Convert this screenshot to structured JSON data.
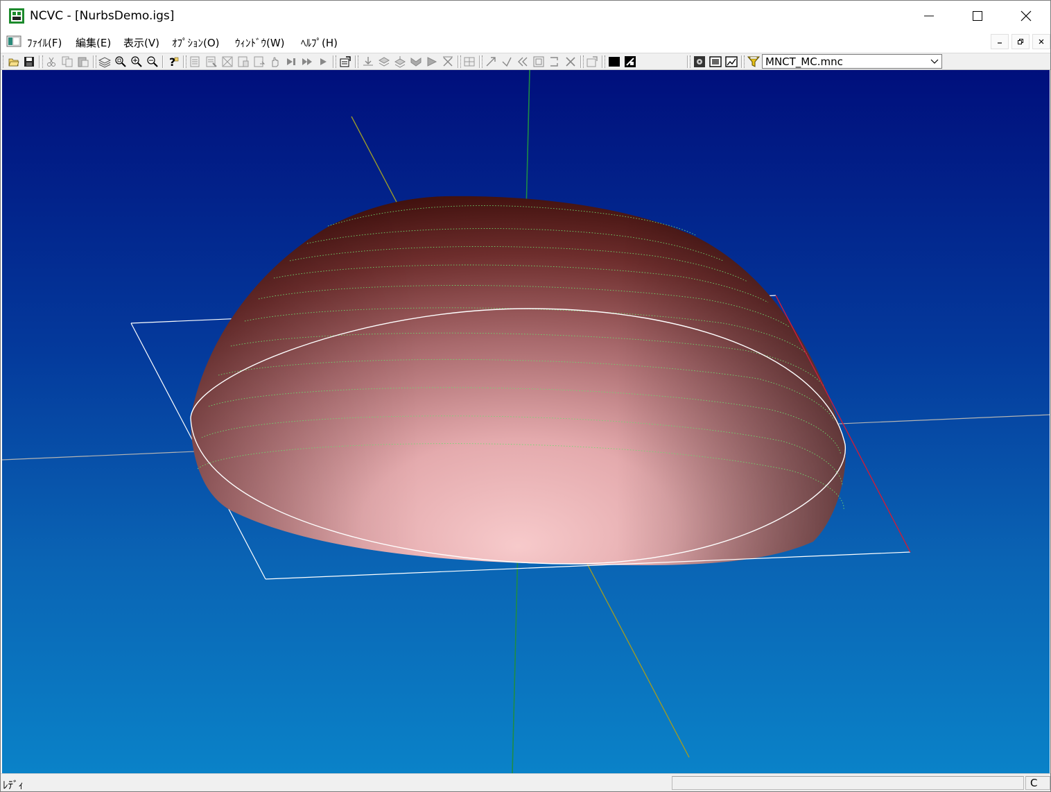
{
  "window": {
    "title": "NCVC - [NurbsDemo.igs]"
  },
  "menu": {
    "items": [
      {
        "label": "ﾌｧｲﾙ(F)"
      },
      {
        "label": "編集(E)"
      },
      {
        "label": "表示(V)"
      },
      {
        "label": "ｵﾌﾟｼｮﾝ(O)"
      },
      {
        "label": "ｳｨﾝﾄﾞｳ(W)"
      },
      {
        "label": "ﾍﾙﾌﾟ(H)"
      }
    ]
  },
  "toolbar": {
    "mc_file": {
      "selected": "MNCT_MC.mnc"
    },
    "icons": [
      "open-icon",
      "save-icon",
      "cut-icon",
      "copy-icon",
      "paste-icon",
      "layer-icon",
      "zoom-fit-icon",
      "zoom-in-icon",
      "zoom-out-icon",
      "help-icon",
      "nc-generate-icon",
      "play-icon",
      "color-icon",
      "machine-icon"
    ]
  },
  "status": {
    "text": "ﾚﾃﾞｨ",
    "pane": "C"
  },
  "colors": {
    "viewport_top": "#000f7c",
    "viewport_bottom": "#0a82c8",
    "surface_light": "#f6c5c7",
    "surface_dark": "#5a1e1a",
    "contour_lines": "#6edc6e",
    "axis_x": "#b4b4b4",
    "axis_y": "#1e8c46",
    "axis_z": "#9a9a2a",
    "workpiece_box": "#ffffff",
    "workpiece_edge_highlight": "#c81e3c"
  }
}
